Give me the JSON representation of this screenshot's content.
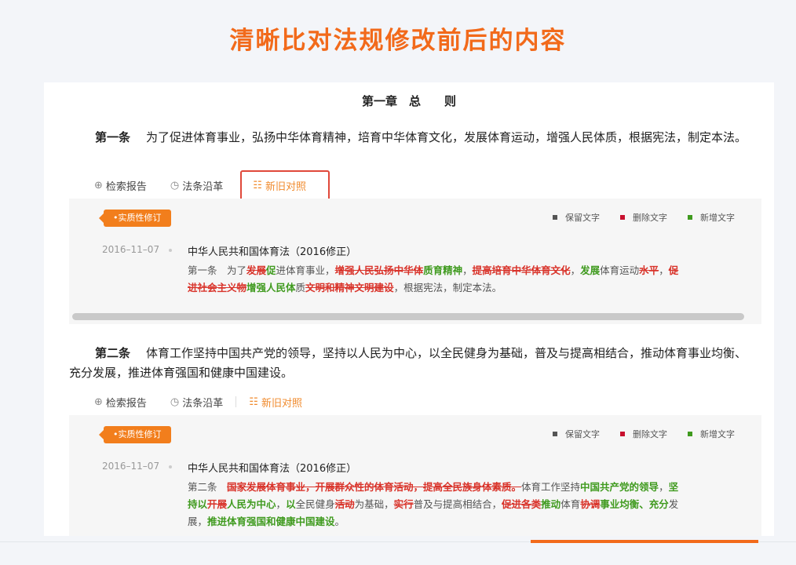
{
  "headline": "清晰比对法规修改前后的内容",
  "chapter_title": "第一章　总　　则",
  "toolbar": {
    "search_report": "检索报告",
    "history": "法条沿革",
    "compare": "新旧对照"
  },
  "legend": {
    "keep": "保留文字",
    "delete": "删除文字",
    "add": "新增文字"
  },
  "colors": {
    "accent": "#f26a1b",
    "delete": "#d9342b",
    "add": "#3f9a1e",
    "keep": "#555555"
  },
  "articles": [
    {
      "number": "第一条",
      "text": "为了促进体育事业，弘扬中华体育精神，培育中华体育文化，发展体育运动，增强人民体质，根据宪法，制定本法。",
      "badge": "•实质性修订",
      "date": "2016–11–07",
      "law_title": "中华人民共和国体育法（2016修正）",
      "diff_line1": [
        {
          "t": "第一条　为了",
          "k": "keep"
        },
        {
          "t": "发展",
          "k": "del"
        },
        {
          "t": "促",
          "k": "add"
        },
        {
          "t": "进体育事业，",
          "k": "keep"
        },
        {
          "t": "增强人民弘扬中华体",
          "k": "del"
        },
        {
          "t": "质育精神",
          "k": "add"
        },
        {
          "t": "，",
          "k": "keep"
        },
        {
          "t": "提高培育中华体育文化",
          "k": "del"
        },
        {
          "t": "，",
          "k": "keep"
        },
        {
          "t": "发展",
          "k": "add"
        },
        {
          "t": "体育运动",
          "k": "keep"
        },
        {
          "t": "水平",
          "k": "del"
        },
        {
          "t": "，",
          "k": "keep"
        },
        {
          "t": "促",
          "k": "del"
        }
      ],
      "diff_line2": [
        {
          "t": "进社会主义物",
          "k": "del"
        },
        {
          "t": "增强人民体",
          "k": "add"
        },
        {
          "t": "质",
          "k": "keep"
        },
        {
          "t": "文明和精神文明建设",
          "k": "del"
        },
        {
          "t": "，根据宪法，制定本法。",
          "k": "keep"
        }
      ]
    },
    {
      "number": "第二条",
      "text": "体育工作坚持中国共产党的领导，坚持以人民为中心，以全民健身为基础，普及与提高相结合，推动体育事业均衡、充分发展，推进体育强国和健康中国建设。",
      "badge": "•实质性修订",
      "date": "2016–11–07",
      "law_title": "中华人民共和国体育法（2016修正）",
      "diff_line1": [
        {
          "t": "第二条　",
          "k": "keep"
        },
        {
          "t": "国家发展体育事业，开展群众性的体育活动，提高全民族身体素质。",
          "k": "del"
        },
        {
          "t": "体育工作坚持",
          "k": "keep"
        },
        {
          "t": "中国共产党的领导",
          "k": "add"
        },
        {
          "t": "，",
          "k": "keep"
        },
        {
          "t": "坚",
          "k": "add"
        }
      ],
      "diff_line2": [
        {
          "t": "持以",
          "k": "add"
        },
        {
          "t": "开展",
          "k": "del"
        },
        {
          "t": "人民为中心",
          "k": "add"
        },
        {
          "t": "，",
          "k": "keep"
        },
        {
          "t": "以",
          "k": "add"
        },
        {
          "t": "全民健身",
          "k": "keep"
        },
        {
          "t": "活动",
          "k": "del"
        },
        {
          "t": "为基础，",
          "k": "keep"
        },
        {
          "t": "实行",
          "k": "del"
        },
        {
          "t": "普及与提高相结合，",
          "k": "keep"
        },
        {
          "t": "促进各类",
          "k": "del"
        },
        {
          "t": "推动",
          "k": "add"
        },
        {
          "t": "体育",
          "k": "keep"
        },
        {
          "t": "协调",
          "k": "del"
        },
        {
          "t": "事业均衡、充分",
          "k": "add"
        },
        {
          "t": "发",
          "k": "keep"
        }
      ],
      "diff_line3": [
        {
          "t": "展，",
          "k": "keep"
        },
        {
          "t": "推进体育强国和健康中国建设",
          "k": "add"
        },
        {
          "t": "。",
          "k": "keep"
        }
      ]
    }
  ]
}
